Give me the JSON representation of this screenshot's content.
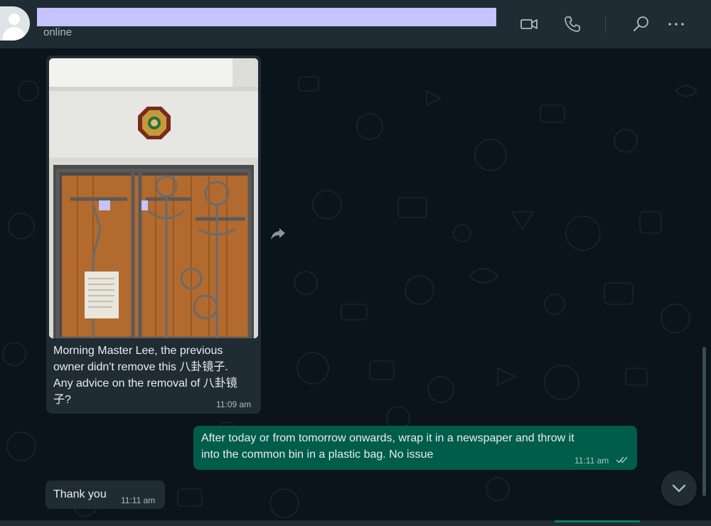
{
  "header": {
    "contact_status": "online",
    "icons": [
      "video-call-icon",
      "voice-call-icon",
      "search-icon",
      "menu-icon"
    ]
  },
  "messages": [
    {
      "direction": "in",
      "type": "image",
      "text": "Morning Master Lee, the previous owner didn't remove this 八卦镜子. Any advice on the removal of 八卦镜子?",
      "lines": [
        "Morning Master Lee, the previous",
        "owner didn't remove this 八卦镜子.",
        "Any advice on the removal of 八卦镜",
        "子?"
      ],
      "time": "11:09 am"
    },
    {
      "direction": "out",
      "type": "text",
      "lines": [
        "After today or from tomorrow onwards, wrap it in a newspaper and throw it",
        "into the common bin in a plastic bag. No issue"
      ],
      "time": "11:11 am",
      "read_status": "double-check-icon"
    },
    {
      "direction": "in",
      "type": "text",
      "lines": [
        "Thank you"
      ],
      "time": "11:11 am"
    }
  ],
  "colors": {
    "header_bg": "#202c33",
    "chat_bg": "#0b141a",
    "incoming_bubble": "#202c33",
    "outgoing_bubble": "#005c4b",
    "redaction": "#c6c3ff"
  }
}
